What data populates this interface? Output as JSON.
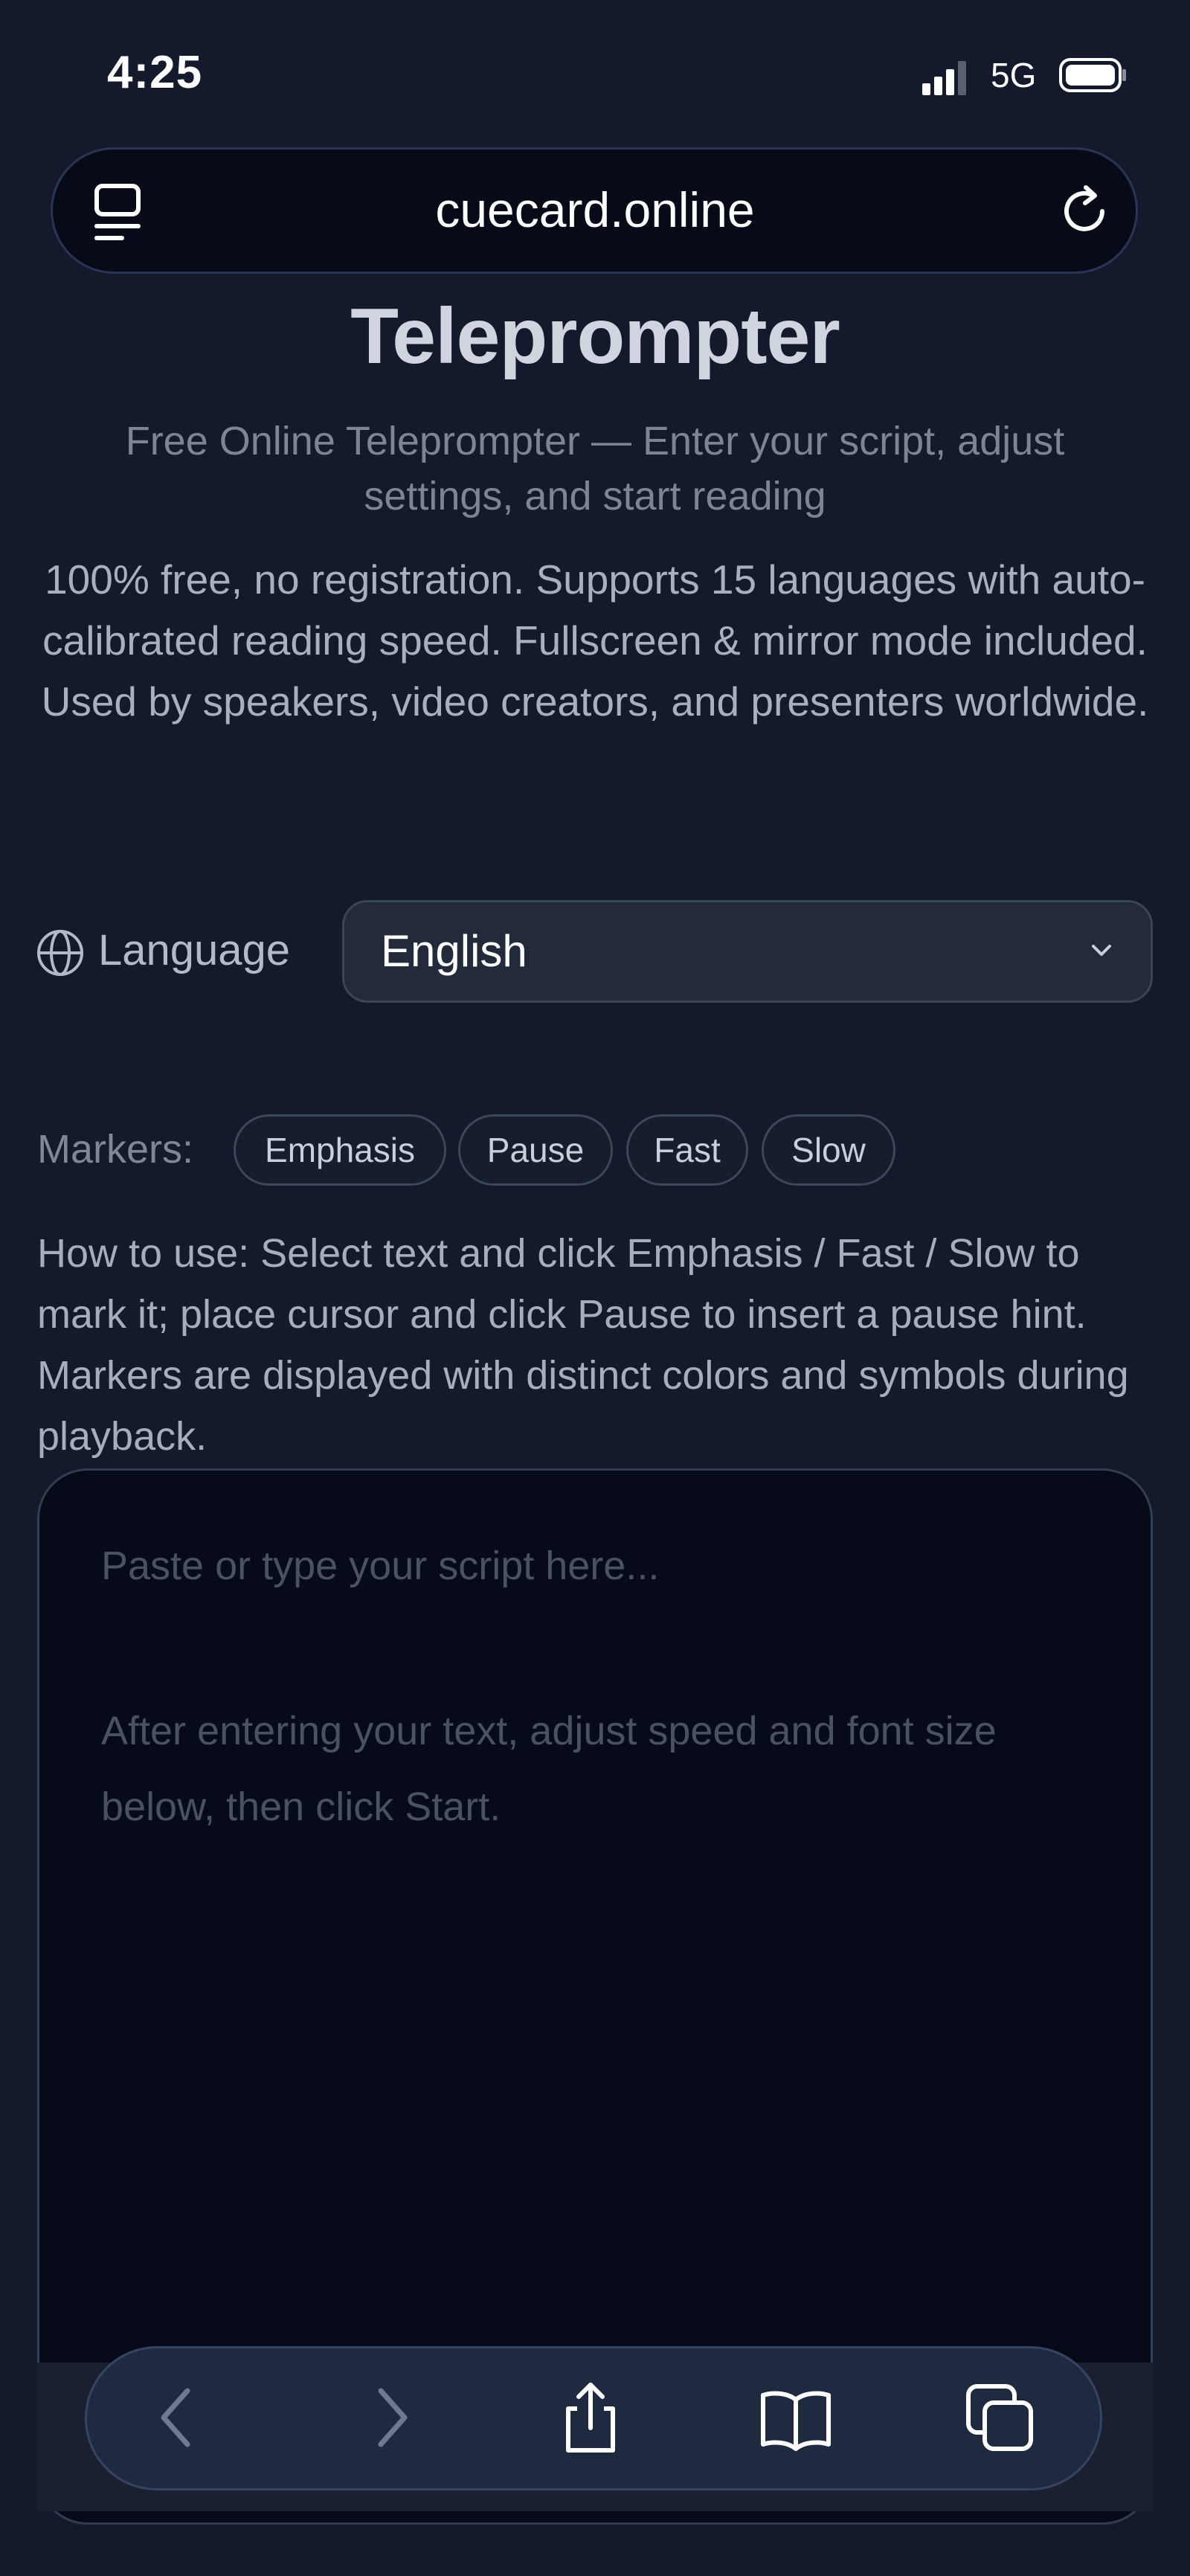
{
  "status_bar": {
    "time": "4:25",
    "network": "5G",
    "icons": [
      "signal-icon",
      "battery-icon"
    ]
  },
  "browser": {
    "url": "cuecard.online",
    "icons": [
      "reader-menu-icon",
      "reload-icon"
    ],
    "toolbar_icons": [
      "back-icon",
      "forward-icon",
      "share-icon",
      "bookmarks-icon",
      "tabs-icon"
    ]
  },
  "page": {
    "title": "Teleprompter",
    "subtitle": "Free Online Teleprompter — Enter your script, adjust settings, and start reading",
    "description": "100% free, no registration. Supports 15 languages with auto-calibrated reading speed. Fullscreen & mirror mode included. Used by speakers, video creators, and presenters worldwide."
  },
  "language": {
    "label": "Language",
    "selected": "English",
    "icon": "globe-icon"
  },
  "markers": {
    "label": "Markers:",
    "chips": [
      "Emphasis",
      "Pause",
      "Fast",
      "Slow"
    ],
    "how_to": "How to use: Select text and click Emphasis / Fast / Slow to mark it; place cursor and click Pause to insert a pause hint. Markers are displayed with distinct colors and symbols during playback."
  },
  "editor": {
    "placeholder_line1": "Paste or type your script here...",
    "placeholder_line2": "After entering your text, adjust speed and font size below, then click Start."
  },
  "colors": {
    "background": "#141a2b",
    "editor_bg": "#070a18",
    "text_muted": "#7c8496"
  }
}
